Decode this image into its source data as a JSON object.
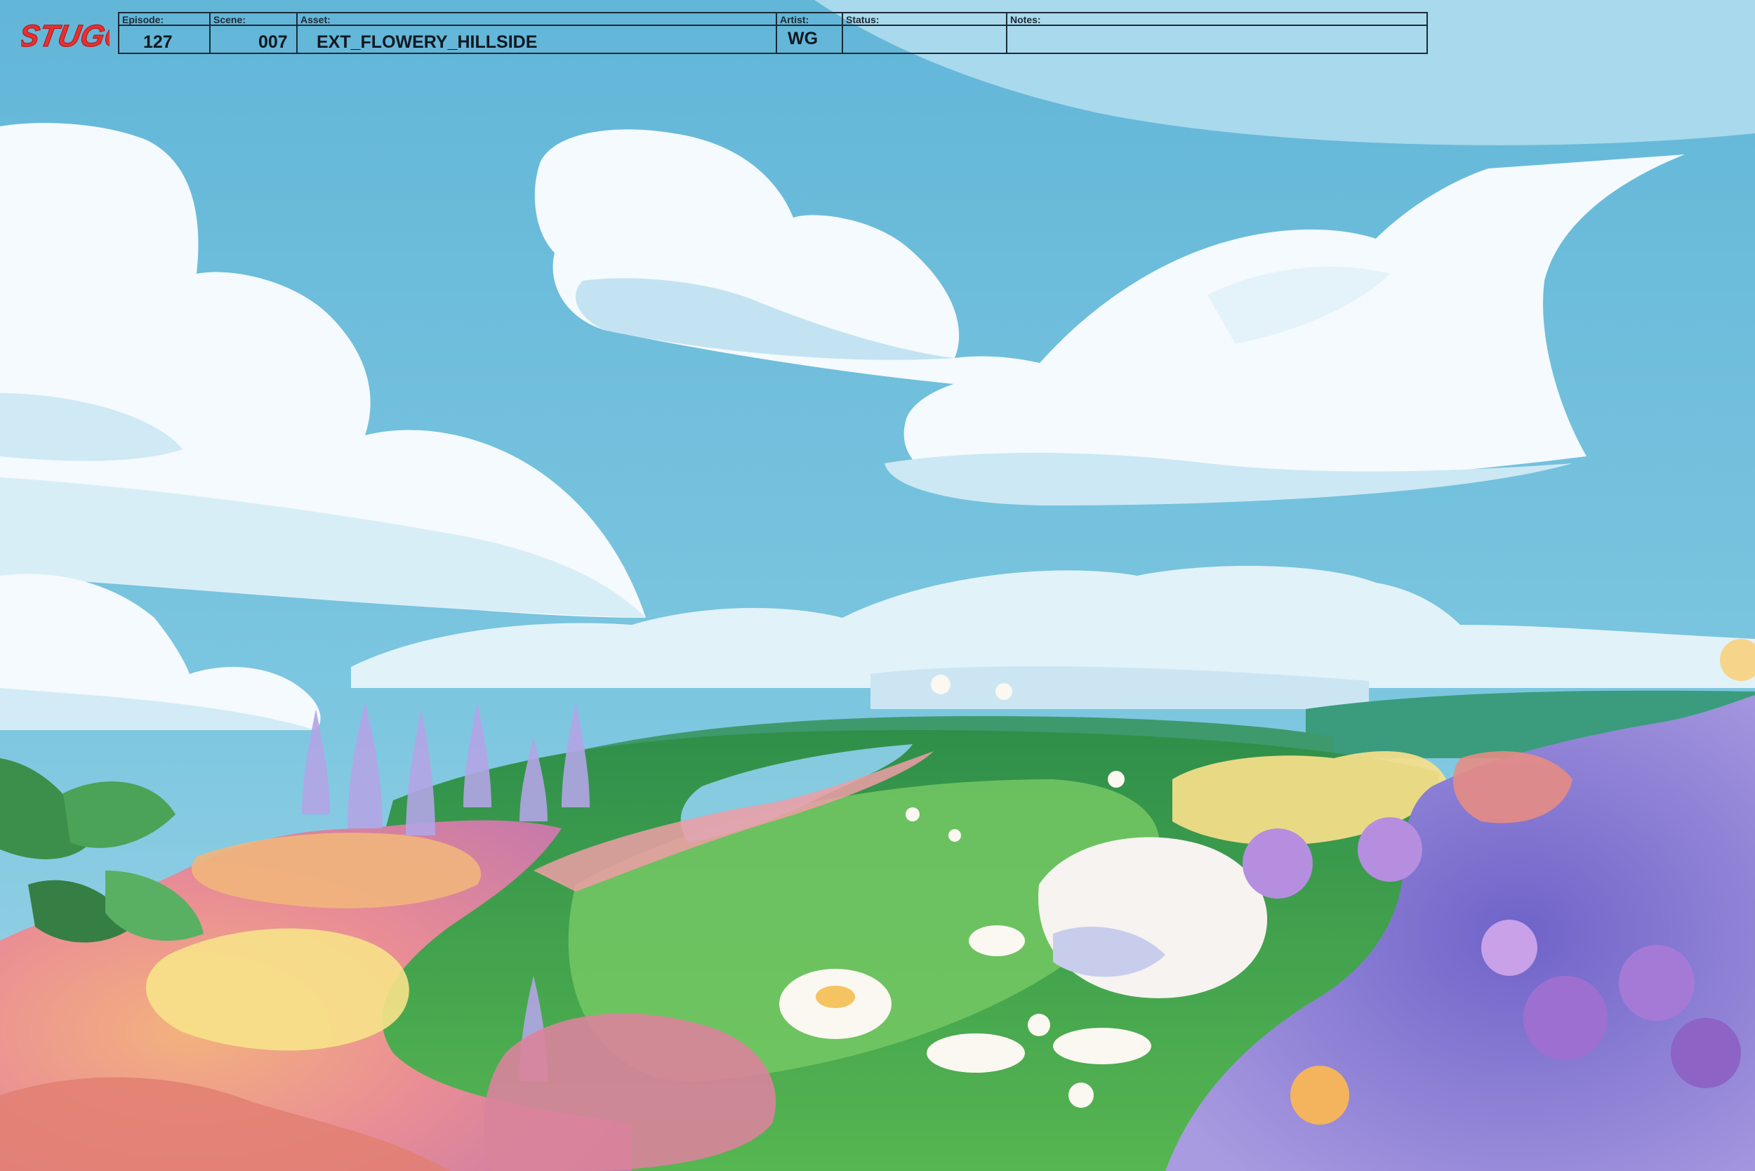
{
  "logo": {
    "text": "STUGO",
    "color": "#e8302f"
  },
  "slate": {
    "episode": {
      "label": "Episode:",
      "value": "127"
    },
    "scene": {
      "label": "Scene:",
      "value": "007"
    },
    "asset": {
      "label": "Asset:",
      "value": "EXT_FLOWERY_HILLSIDE"
    },
    "artist": {
      "label": "Artist:",
      "value": "WG"
    },
    "status": {
      "label": "Status:",
      "value": ""
    },
    "notes": {
      "label": "Notes:",
      "value": ""
    }
  },
  "palette": {
    "sky": "#6fbfdc",
    "cloud": "#f4fafd",
    "cloud_shadow": "#c6e6f3",
    "hill_green": "#3fa34b",
    "hill_light": "#6cc35a",
    "flower_purple": "#8f82d6",
    "flower_pink": "#e88a8c",
    "flower_yellow": "#f7e28a",
    "slate_border": "#1d2a35"
  }
}
